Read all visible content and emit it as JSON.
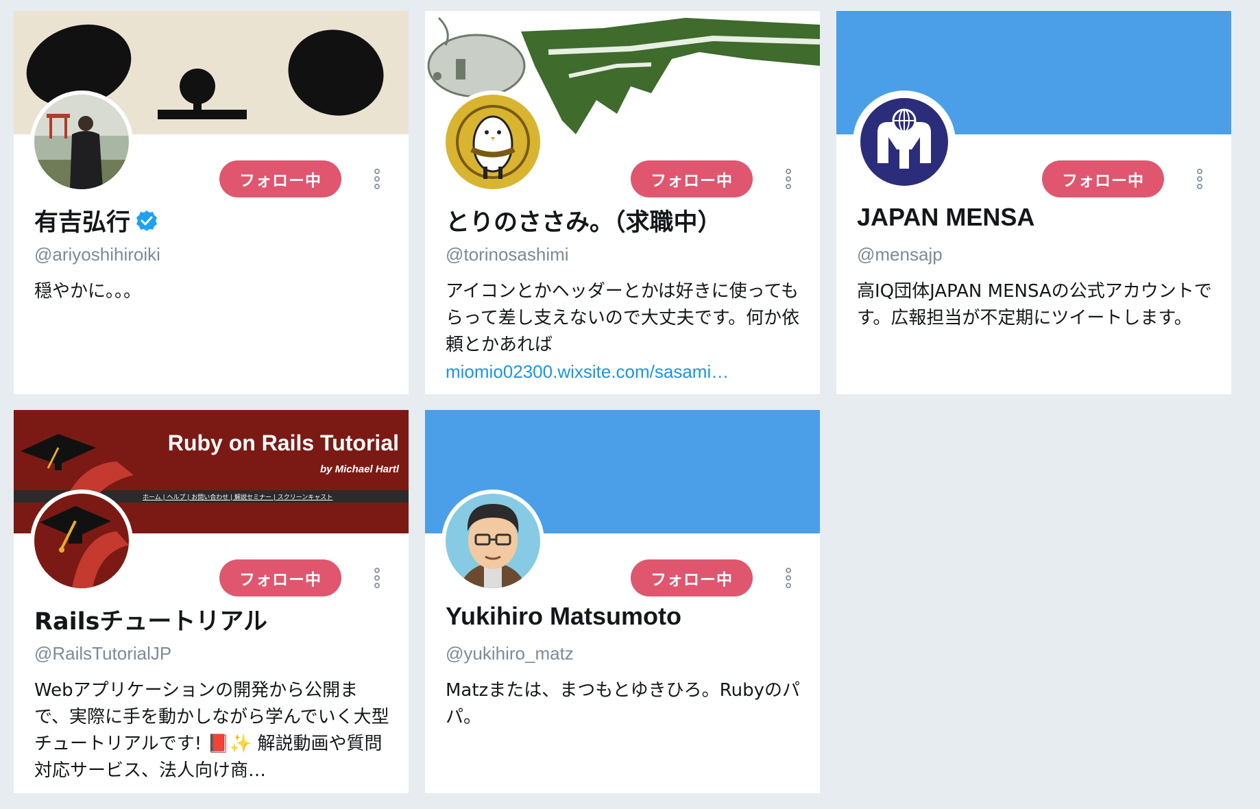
{
  "colors": {
    "page_bg": "#e6ecf0",
    "follow_button": "#e0566f",
    "link": "#1b95e0",
    "twitter_blue": "#4a9fe8"
  },
  "cards": [
    {
      "name": "有吉弘行",
      "verified": true,
      "handle": "@ariyoshihiroiki",
      "bio": "穏やかに。。。",
      "follow_label": "フォロー中",
      "header_icon": "panda-face-banner",
      "avatar_icon": "person-photo-avatar"
    },
    {
      "name": "とりのささみ。（求職中）",
      "handle": "@torinosashimi",
      "bio": "アイコンとかヘッダーとかは好きに使ってもらって差し支えないので大丈夫です。何か依頼とかあれば",
      "bio_link": "miomio02300.wixsite.com/sasami…",
      "follow_label": "フォロー中",
      "header_icon": "illustration-banner",
      "avatar_icon": "bird-character-avatar"
    },
    {
      "name": "JAPAN MENSA",
      "handle": "@mensajp",
      "bio": "高IQ団体JAPAN MENSAの公式アカウントです。広報担当が不定期にツイートします。",
      "follow_label": "フォロー中",
      "header_icon": "blue-banner",
      "avatar_icon": "mensa-logo-avatar"
    },
    {
      "name": "Railsチュートリアル",
      "handle": "@RailsTutorialJP",
      "bio": "Webアプリケーションの開発から公開まで、実際に手を動かしながら学んでいく大型チュートリアルです! 📕✨ 解説動画や質問対応サービス、法人向け商…",
      "follow_label": "フォロー中",
      "header_title": "Ruby on Rails Tutorial",
      "header_subtitle": "by Michael Hartl",
      "header_nav": "ホーム | ヘルプ | お問い合わせ | 解説セミナー | スクリーンキャスト",
      "header_icon": "rails-tutorial-banner",
      "avatar_icon": "graduation-cap-avatar"
    },
    {
      "name": "Yukihiro Matsumoto",
      "handle": "@yukihiro_matz",
      "bio": "Matzまたは、まつもとゆきひろ。Rubyのパパ。",
      "follow_label": "フォロー中",
      "header_icon": "blue-banner",
      "avatar_icon": "cartoon-face-avatar"
    }
  ]
}
